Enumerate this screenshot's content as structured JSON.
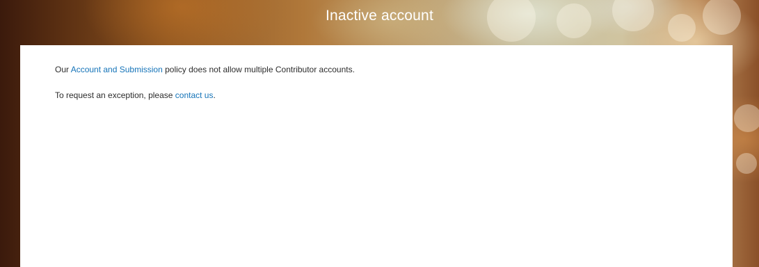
{
  "page": {
    "title": "Inactive account"
  },
  "message": {
    "line1_prefix": "Our ",
    "line1_link": "Account and Submission",
    "line1_suffix": " policy does not allow multiple Contributor accounts.",
    "line2_prefix": "To request an exception, please ",
    "line2_link": "contact us",
    "line2_suffix": "."
  },
  "colors": {
    "link": "#1473b8",
    "text": "#2c2c2c",
    "header_text": "#ffffff",
    "panel": "#ffffff"
  }
}
